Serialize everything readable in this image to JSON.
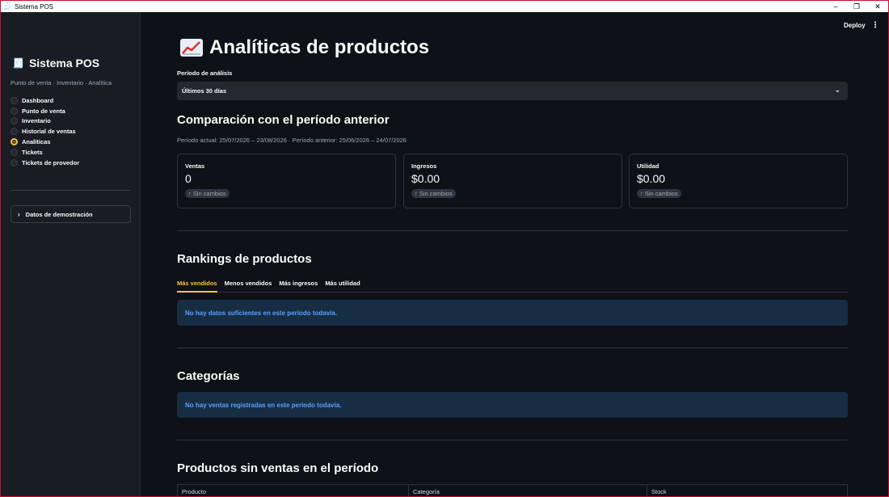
{
  "window": {
    "title": "Sistema POS",
    "controls": [
      "–",
      "❐",
      "✕"
    ]
  },
  "sidebar": {
    "brand": "Sistema POS",
    "tagline": "Punto de venta · Inventario · Analítica",
    "nav": [
      {
        "label": "Dashboard",
        "selected": false
      },
      {
        "label": "Punto de venta",
        "selected": false
      },
      {
        "label": "Inventario",
        "selected": false
      },
      {
        "label": "Historial de ventas",
        "selected": false
      },
      {
        "label": "Analíticas",
        "selected": true
      },
      {
        "label": "Tickets",
        "selected": false
      },
      {
        "label": "Tickets de provedor",
        "selected": false
      }
    ],
    "expander": "Datos de demostración"
  },
  "topbar": {
    "deploy": "Deploy",
    "menu": "⋮"
  },
  "main": {
    "title": "Analíticas de productos",
    "period_label": "Período de análisis",
    "period_value": "Últimos 30 días",
    "comparison_title": "Comparación con el período anterior",
    "comparison_caption": "Período actual: 25/07/2026 – 23/08/2026 · Período anterior: 25/06/2026 – 24/07/2026",
    "metrics": [
      {
        "label": "Ventas",
        "value": "0",
        "delta": "Sin cambios"
      },
      {
        "label": "Ingresos",
        "value": "$0.00",
        "delta": "Sin cambios"
      },
      {
        "label": "Utilidad",
        "value": "$0.00",
        "delta": "Sin cambios"
      }
    ],
    "rankings_title": "Rankings de productos",
    "tabs": [
      {
        "label": "Más vendidos",
        "active": true
      },
      {
        "label": "Menos vendidos",
        "active": false
      },
      {
        "label": "Más ingresos",
        "active": false
      },
      {
        "label": "Más utilidad",
        "active": false
      }
    ],
    "rankings_info": "No hay datos suficientes en este período todavía.",
    "categories_title": "Categorías",
    "categories_info": "No hay ventas registradas en este período todavía.",
    "nosales_title": "Productos sin ventas en el período",
    "table_headers": [
      "Producto",
      "Categoría",
      "Stock"
    ]
  },
  "colors": {
    "accent": "#f4c542",
    "background": "#0e1117",
    "sidebar": "#1a1c24",
    "info_bg": "#172d43",
    "info_text": "#5aa0ff"
  }
}
